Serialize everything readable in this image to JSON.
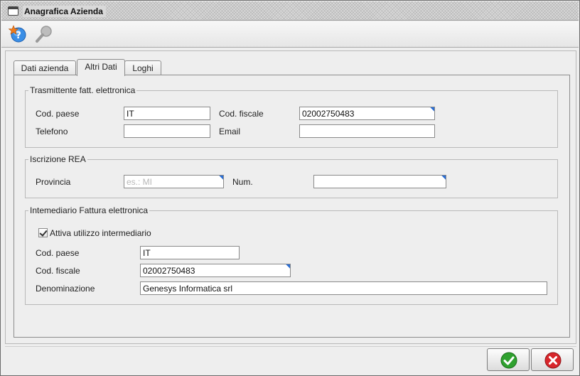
{
  "window": {
    "title": "Anagrafica Azienda"
  },
  "toolbar": {
    "help_icon": "help-star-icon",
    "search_icon": "search-icon"
  },
  "tabs": [
    {
      "label": "Dati azienda",
      "active": false
    },
    {
      "label": "Altri Dati",
      "active": true
    },
    {
      "label": "Loghi",
      "active": false
    }
  ],
  "trasmittente": {
    "legend": "Trasmittente fatt. elettronica",
    "cod_paese_label": "Cod. paese",
    "cod_paese_value": "IT",
    "cod_fiscale_label": "Cod. fiscale",
    "cod_fiscale_value": "02002750483",
    "telefono_label": "Telefono",
    "telefono_value": "",
    "email_label": "Email",
    "email_value": ""
  },
  "rea": {
    "legend": "Iscrizione REA",
    "provincia_label": "Provincia",
    "provincia_placeholder": "es.: MI",
    "num_label": "Num.",
    "num_value": ""
  },
  "intermediario": {
    "legend": "Intemediario Fattura elettronica",
    "attiva_label": "Attiva utilizzo intermediario",
    "attiva_checked": true,
    "cod_paese_label": "Cod. paese",
    "cod_paese_value": "IT",
    "cod_fiscale_label": "Cod. fiscale",
    "cod_fiscale_value": "02002750483",
    "denominazione_label": "Denominazione",
    "denominazione_value": "Genesys Informatica srl"
  },
  "colors": {
    "ok": "#2fa12f",
    "cancel": "#d8262b",
    "required_marker": "#2b6fd6"
  }
}
